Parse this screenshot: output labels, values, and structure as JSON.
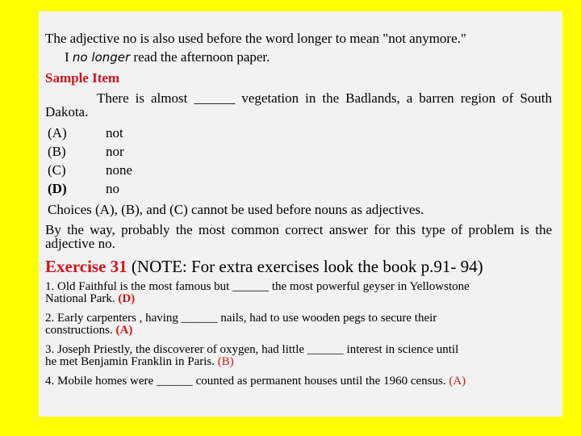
{
  "colors": {
    "background": "#ffff00",
    "panel": "#f2f2f2",
    "accent_red": "#d0151d",
    "text": "#000000"
  },
  "intro": {
    "line1": "The adjective no is also used before the word longer to mean \"not anymore.\"",
    "example_prefix": "I ",
    "example_italic": "no longer",
    "example_suffix": " read the afternoon paper."
  },
  "sample": {
    "heading": "Sample Item",
    "question_line1": "There is almost ______ vegetation in the Badlands, a barren region of",
    "question_line2": "South Dakota.",
    "options": [
      {
        "letter": "(A)",
        "text": "not"
      },
      {
        "letter": "(B)",
        "text": "nor"
      },
      {
        "letter": "(C)",
        "text": "none"
      },
      {
        "letter": "(D)",
        "text": "no"
      }
    ],
    "explanation": "Choices (A), (B), and (C) cannot be used before nouns as adjectives.",
    "note_line1": "By the way, probably the most common correct answer for this type of",
    "note_line2": "problem is the adjective no."
  },
  "exercise": {
    "title": "Exercise 31",
    "note": " (NOTE: For extra exercises look the book p.91- 94)",
    "items": [
      {
        "line1": "1. Old Faithful is the most famous but ______ the most powerful geyser in Yellowstone",
        "line2": "National Park. ",
        "answer": "(D)"
      },
      {
        "line1": "2. Early carpenters , having ______ nails, had to use wooden pegs to secure their",
        "line2": "constructions. ",
        "answer": "(A)"
      },
      {
        "line1": "3. Joseph Priestly, the discoverer of oxygen, had little ______  interest in science until",
        "line2": "he met Benjamin Franklin in Paris. ",
        "answer": "(B)"
      },
      {
        "line1": "4. Mobile homes were ______ counted as permanent houses until the 1960 census. ",
        "answer": "(A)"
      }
    ]
  }
}
